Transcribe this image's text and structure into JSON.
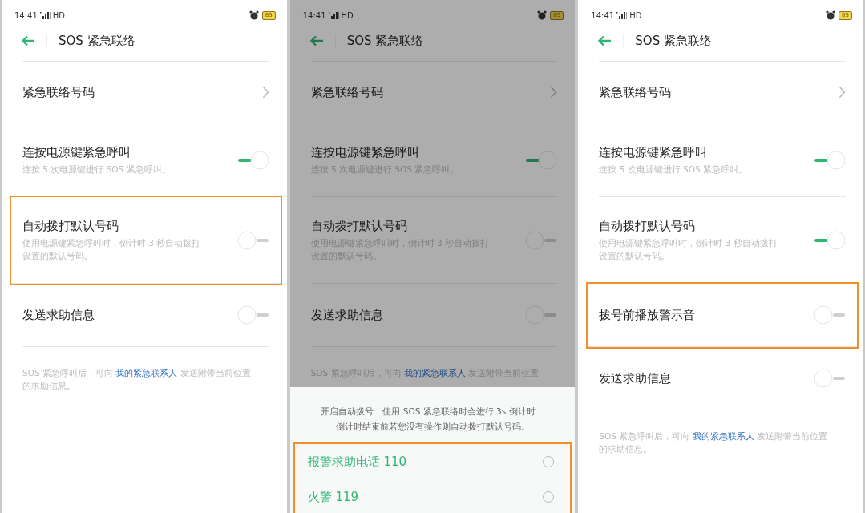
{
  "panels": [
    {
      "status_bar": {
        "time": "14:41",
        "network": "HD",
        "battery": "85"
      },
      "title": "SOS 紧急联络",
      "dimmed": false,
      "rows": [
        {
          "kind": "link",
          "title": "紧急联络号码"
        },
        {
          "kind": "switch",
          "title": "连按电源键紧急呼叫",
          "subtitle": "连按 5 次电源键进行 SOS 紧急呼叫。",
          "on": true,
          "highlighted": false
        },
        {
          "kind": "switch",
          "title": "自动拨打默认号码",
          "subtitle_lines": [
            "使用电源键紧急呼叫时，倒计时 3 秒自动拨打",
            "设置的默认号码。"
          ],
          "on": false,
          "highlighted": true
        },
        {
          "kind": "switch",
          "title": "发送求助信息",
          "on": false,
          "highlighted": false
        }
      ],
      "footnote": {
        "lines": [
          [
            "SOS 紧急呼叫后，可向 ",
            "我的紧急联系人",
            " 发送附带当前位置"
          ],
          [
            "的求助信息。"
          ]
        ]
      }
    },
    {
      "status_bar": {
        "time": "14:41",
        "network": "HD",
        "battery": "85"
      },
      "title": "SOS 紧急联络",
      "dimmed": true,
      "rows": [
        {
          "kind": "link",
          "title": "紧急联络号码"
        },
        {
          "kind": "switch",
          "title": "连按电源键紧急呼叫",
          "subtitle": "连按 5 次电源键进行 SOS 紧急呼叫。",
          "on": true,
          "highlighted": false
        },
        {
          "kind": "switch",
          "title": "自动拨打默认号码",
          "subtitle_lines": [
            "使用电源键紧急呼叫时，倒计时 3 秒自动拨打",
            "设置的默认号码。"
          ],
          "on": false,
          "highlighted": false
        },
        {
          "kind": "switch",
          "title": "发送求助信息",
          "on": false,
          "highlighted": false
        }
      ],
      "footnote": {
        "lines": [
          [
            "SOS 紧急呼叫后，可向 ",
            "我的紧急联系人",
            " 发送附带当前位置"
          ]
        ]
      },
      "sheet": {
        "message_lines": [
          "开启自动拨号，使用 SOS 紧急联络时会进行 3s 倒计时，",
          "倒计时结束前若您没有操作则自动拨打默认号码。"
        ],
        "highlighted": true,
        "options": [
          {
            "label": "报警求助电话 110",
            "selected": false
          },
          {
            "label": "火警 119",
            "selected": false
          }
        ]
      }
    },
    {
      "status_bar": {
        "time": "14:41",
        "network": "HD",
        "battery": "85"
      },
      "title": "SOS 紧急联络",
      "dimmed": false,
      "rows": [
        {
          "kind": "link",
          "title": "紧急联络号码"
        },
        {
          "kind": "switch",
          "title": "连按电源键紧急呼叫",
          "subtitle": "连按 5 次电源键进行 SOS 紧急呼叫。",
          "on": true,
          "highlighted": false
        },
        {
          "kind": "switch",
          "title": "自动拨打默认号码",
          "subtitle_lines": [
            "使用电源键紧急呼叫时，倒计时 3 秒自动拨打",
            "设置的默认号码。"
          ],
          "on": true,
          "highlighted": false
        },
        {
          "kind": "switch",
          "title": "拨号前播放警示音",
          "on": false,
          "highlighted": true
        },
        {
          "kind": "switch",
          "title": "发送求助信息",
          "on": false,
          "highlighted": false
        }
      ],
      "footnote": {
        "lines": [
          [
            "SOS 紧急呼叫后，可向 ",
            "我的紧急联系人",
            " 发送附带当前位置"
          ],
          [
            "的求助信息。"
          ]
        ]
      }
    }
  ]
}
